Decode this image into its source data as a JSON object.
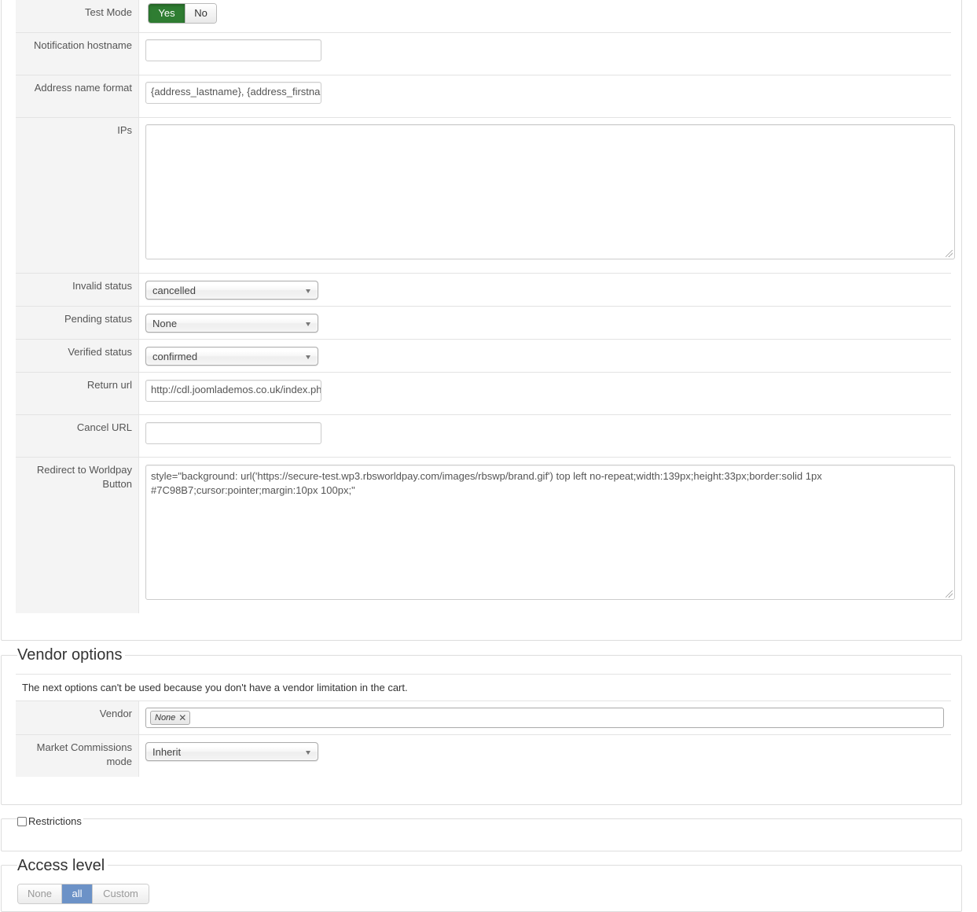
{
  "payment_settings": {
    "test_mode": {
      "label": "Test Mode",
      "yes": "Yes",
      "no": "No",
      "selected": "Yes"
    },
    "notification_hostname": {
      "label": "Notification hostname",
      "value": ""
    },
    "address_name_format": {
      "label": "Address name format",
      "value": "{address_lastname}, {address_firstname}"
    },
    "ips": {
      "label": "IPs",
      "value": ""
    },
    "invalid_status": {
      "label": "Invalid status",
      "value": "cancelled"
    },
    "pending_status": {
      "label": "Pending status",
      "value": "None"
    },
    "verified_status": {
      "label": "Verified status",
      "value": "confirmed"
    },
    "return_url": {
      "label": "Return url",
      "value": "http://cdl.joomlademos.co.uk/index.php"
    },
    "cancel_url": {
      "label": "Cancel URL",
      "value": ""
    },
    "redirect_button": {
      "label": "Redirect to Worldpay Button",
      "value": "style=\"background: url('https://secure-test.wp3.rbsworldpay.com/images/rbswp/brand.gif') top left no-repeat;width:139px;height:33px;border:solid 1px #7C98B7;cursor:pointer;margin:10px 100px;\""
    }
  },
  "vendor_options": {
    "title": "Vendor options",
    "notice": "The next options can't be used because you don't have a vendor limitation in the cart.",
    "vendor": {
      "label": "Vendor",
      "tag": "None"
    },
    "market_commissions": {
      "label": "Market Commissions mode",
      "value": "Inherit"
    }
  },
  "restrictions": {
    "label": "Restrictions",
    "checked": false
  },
  "access_level": {
    "title": "Access level",
    "options": [
      "None",
      "all",
      "Custom"
    ],
    "selected": "all"
  },
  "colors": {
    "toggle_active": "#2f7d32",
    "access_active": "#6c92c7",
    "label_bg": "#f4f4f4",
    "border": "#dddddd"
  }
}
